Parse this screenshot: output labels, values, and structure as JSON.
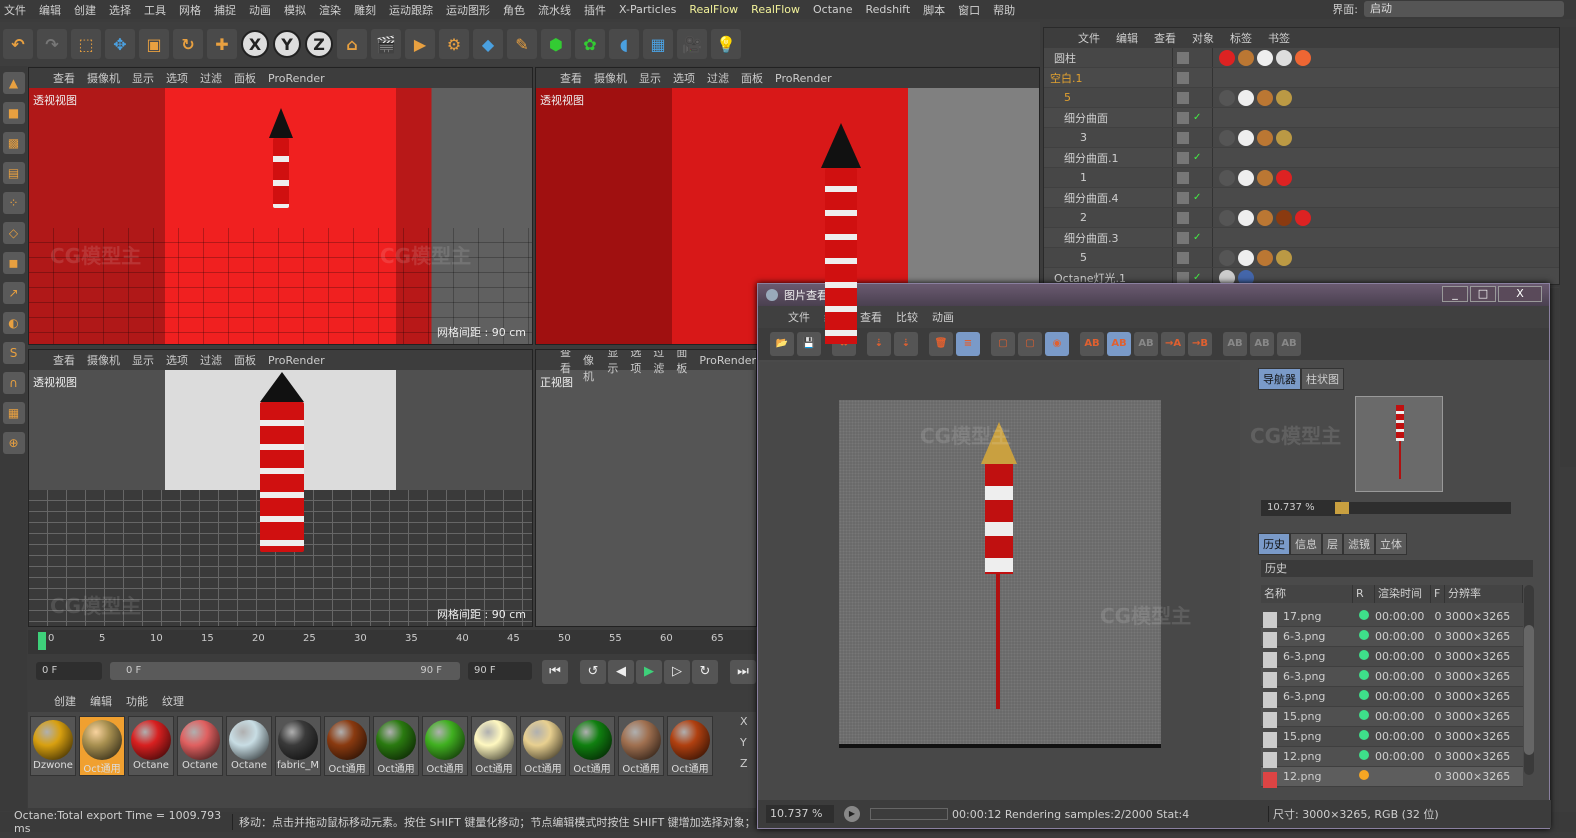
{
  "menubar": {
    "items": [
      "文件",
      "编辑",
      "创建",
      "选择",
      "工具",
      "网格",
      "捕捉",
      "动画",
      "模拟",
      "渲染",
      "雕刻",
      "运动跟踪",
      "运动图形",
      "角色",
      "流水线",
      "插件",
      "X-Particles",
      "RealFlow",
      "RealFlow",
      "Octane",
      "Redshift",
      "脚本",
      "窗口",
      "帮助"
    ],
    "layout_label": "界面:",
    "layout_value": "启动"
  },
  "viewport_menu": [
    "查看",
    "摄像机",
    "显示",
    "选项",
    "过滤",
    "面板",
    "ProRender"
  ],
  "viewports": [
    {
      "label": "透视视图",
      "grid": "网格间距 : 90 cm"
    },
    {
      "label": "透视视图",
      "grid": ""
    },
    {
      "label": "透视视图",
      "grid": "网格间距 : 90 cm"
    },
    {
      "label": "正视图",
      "grid": ""
    }
  ],
  "object_manager": {
    "menu": [
      "文件",
      "编辑",
      "查看",
      "对象",
      "标签",
      "书签"
    ],
    "rows": [
      {
        "name": "圆柱",
        "check": false
      },
      {
        "name": "空白.1",
        "check": false
      },
      {
        "name": "5",
        "check": false
      },
      {
        "name": "细分曲面",
        "check": true
      },
      {
        "name": "3",
        "check": false
      },
      {
        "name": "细分曲面.1",
        "check": true
      },
      {
        "name": "1",
        "check": false
      },
      {
        "name": "细分曲面.4",
        "check": true
      },
      {
        "name": "2",
        "check": false
      },
      {
        "name": "细分曲面.3",
        "check": true
      },
      {
        "name": "5",
        "check": false
      },
      {
        "name": "Octane灯光.1",
        "check": true
      }
    ]
  },
  "picture_viewer": {
    "title": "图片查看器",
    "menu": [
      "文件",
      "编辑",
      "查看",
      "比较",
      "动画"
    ],
    "nav_tabs": [
      "导航器",
      "柱状图"
    ],
    "zoom": "10.737 %",
    "info_tabs": [
      "历史",
      "信息",
      "层",
      "滤镜",
      "立体"
    ],
    "history_title": "历史",
    "columns": [
      "名称",
      "R",
      "渲染时间",
      "F",
      "分辨率"
    ],
    "history": [
      {
        "name": "17.png",
        "status": "done",
        "time": "00:00:00",
        "f": "0",
        "res": "3000×3265"
      },
      {
        "name": "6-3.png",
        "status": "done",
        "time": "00:00:00",
        "f": "0",
        "res": "3000×3265"
      },
      {
        "name": "6-3.png",
        "status": "done",
        "time": "00:00:00",
        "f": "0",
        "res": "3000×3265"
      },
      {
        "name": "6-3.png",
        "status": "done",
        "time": "00:00:00",
        "f": "0",
        "res": "3000×3265"
      },
      {
        "name": "6-3.png",
        "status": "done",
        "time": "00:00:00",
        "f": "0",
        "res": "3000×3265"
      },
      {
        "name": "15.png",
        "status": "done",
        "time": "00:00:00",
        "f": "0",
        "res": "3000×3265"
      },
      {
        "name": "15.png",
        "status": "done",
        "time": "00:00:00",
        "f": "0",
        "res": "3000×3265"
      },
      {
        "name": "12.png",
        "status": "done",
        "time": "00:00:00",
        "f": "0",
        "res": "3000×3265"
      },
      {
        "name": "12.png",
        "status": "rendering",
        "time": "",
        "f": "0",
        "res": "3000×3265"
      }
    ],
    "status_zoom": "10.737 %",
    "render_status": "00:00:12 Rendering samples:2/2000 Stat:4",
    "size_info": "尺寸: 3000×3265, RGB (32 位)",
    "colors": {
      "done": "#3ee08a",
      "rendering": "#f5a623"
    }
  },
  "timeline": {
    "ticks": [
      "0",
      "5",
      "10",
      "15",
      "20",
      "25",
      "30",
      "35",
      "40",
      "45",
      "50",
      "55",
      "60",
      "65",
      "7"
    ],
    "current_frame": "0 F",
    "range_start": "0 F",
    "range_end": "90 F",
    "end_frame": "90 F"
  },
  "material_manager": {
    "menu": [
      "创建",
      "编辑",
      "功能",
      "纹理"
    ],
    "materials": [
      {
        "name": "Dzwone",
        "color": "#d8a010"
      },
      {
        "name": "Oct通用",
        "color": "#a89050"
      },
      {
        "name": "Octane",
        "color": "#d82020"
      },
      {
        "name": "Octane",
        "color": "#e06060"
      },
      {
        "name": "Octane",
        "color": "#c8dde4"
      },
      {
        "name": "fabric_M",
        "color": "#3a3a3a"
      },
      {
        "name": "Oct通用",
        "color": "#8a3a10"
      },
      {
        "name": "Oct通用",
        "color": "#2a7a10"
      },
      {
        "name": "Oct通用",
        "color": "#40b020"
      },
      {
        "name": "Oct通用",
        "color": "#fff8c0"
      },
      {
        "name": "Oct通用",
        "color": "#e8d090"
      },
      {
        "name": "Oct通用",
        "color": "#108010"
      },
      {
        "name": "Oct通用",
        "color": "#a07050"
      },
      {
        "name": "Oct通用",
        "color": "#b04010"
      }
    ]
  },
  "coord_labels": [
    "X",
    "Y",
    "Z"
  ],
  "status_left": "Octane:Total export Time = 1009.793 ms",
  "status_hint": "移动：点击并拖动鼠标移动元素。按住 SHIFT 键量化移动；节点编辑模式时按住 SHIFT 键增加选择对象；",
  "watermark": "CG模型主"
}
